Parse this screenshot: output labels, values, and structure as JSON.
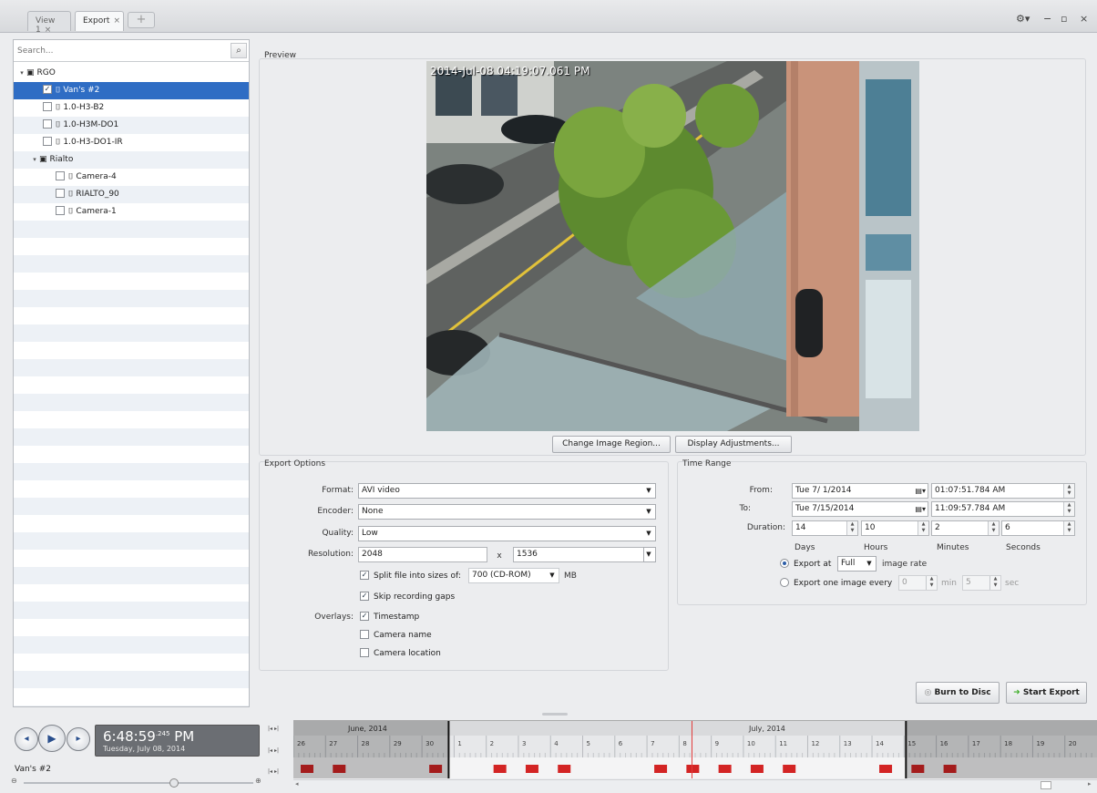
{
  "tabs": [
    {
      "label": "View 1",
      "active": false
    },
    {
      "label": "Export",
      "active": true
    }
  ],
  "tab_add_label": "+",
  "window_controls": {
    "settings": "⚙▾",
    "minimize": "−",
    "restore": "▫",
    "close": "×"
  },
  "search": {
    "placeholder": "Search..."
  },
  "tree": [
    {
      "label": "RGO",
      "type": "site",
      "level": 0,
      "expanded": true,
      "checked": false,
      "selected": false
    },
    {
      "label": "Van's #2",
      "type": "camera",
      "level": 1,
      "checked": true,
      "selected": true
    },
    {
      "label": "1.0-H3-B2",
      "type": "camera",
      "level": 1,
      "checked": false,
      "selected": false
    },
    {
      "label": "1.0-H3M-DO1",
      "type": "camera",
      "level": 1,
      "checked": false,
      "selected": false
    },
    {
      "label": "1.0-H3-DO1-IR",
      "type": "camera",
      "level": 1,
      "checked": false,
      "selected": false
    },
    {
      "label": "Rialto",
      "type": "site",
      "level": 0,
      "expanded": true,
      "checked": false,
      "selected": false
    },
    {
      "label": "Camera-4",
      "type": "camera",
      "level": 2,
      "checked": false,
      "selected": false
    },
    {
      "label": "RIALTO_90",
      "type": "camera",
      "level": 2,
      "checked": false,
      "selected": false
    },
    {
      "label": "Camera-1",
      "type": "camera",
      "level": 2,
      "checked": false,
      "selected": false
    }
  ],
  "preview": {
    "label": "Preview",
    "timestamp": "2014-Jul-08 04:19:07.061 PM",
    "change_region_button": "Change Image Region...",
    "display_adjust_button": "Display Adjustments..."
  },
  "export_options": {
    "title": "Export Options",
    "format_label": "Format:",
    "format_value": "AVI video",
    "encoder_label": "Encoder:",
    "encoder_value": "None",
    "quality_label": "Quality:",
    "quality_value": "Low",
    "resolution_label": "Resolution:",
    "resolution_w": "2048",
    "resolution_x": "x",
    "resolution_h": "1536",
    "split_label": "Split file into sizes of:",
    "split_checked": true,
    "split_value": "700 (CD-ROM)",
    "split_unit": "MB",
    "skip_gaps_label": "Skip recording gaps",
    "skip_gaps_checked": true,
    "overlays_label": "Overlays:",
    "overlay_timestamp": "Timestamp",
    "overlay_timestamp_checked": true,
    "overlay_camera_name": "Camera name",
    "overlay_camera_name_checked": false,
    "overlay_camera_location": "Camera location",
    "overlay_camera_location_checked": false
  },
  "time_range": {
    "title": "Time Range",
    "from_label": "From:",
    "from_date": "Tue  7/ 1/2014",
    "from_time": "01:07:51.784  AM",
    "to_label": "To:",
    "to_date": "Tue  7/15/2014",
    "to_time": "11:09:57.784  AM",
    "duration_label": "Duration:",
    "duration_days": "14",
    "duration_hours": "10",
    "duration_minutes": "2",
    "duration_seconds": "6",
    "days_label": "Days",
    "hours_label": "Hours",
    "minutes_label": "Minutes",
    "seconds_label": "Seconds",
    "export_at_label": "Export at",
    "export_at_value": "Full",
    "image_rate_label": "image rate",
    "export_one_label": "Export one image every",
    "export_one_min": "0",
    "min_label": "min",
    "export_one_sec": "5",
    "sec_label": "sec"
  },
  "actions": {
    "burn_button": "Burn to Disc",
    "start_button": "Start Export"
  },
  "playback": {
    "time": "6:48:59",
    "ms": ".245",
    "ampm": "PM",
    "date": "Tuesday, July 08, 2014",
    "camera_label": "Van's #2"
  },
  "timeline": {
    "month_left": "June, 2014",
    "month_right": "July, 2014",
    "days": [
      "26",
      "27",
      "28",
      "29",
      "30",
      "1",
      "2",
      "3",
      "4",
      "5",
      "6",
      "7",
      "8",
      "9",
      "10",
      "11",
      "12",
      "13",
      "14",
      "15",
      "16",
      "17",
      "18",
      "19",
      "20"
    ],
    "recording_days": [
      "26",
      "27",
      "30",
      "2",
      "3",
      "4",
      "7",
      "8",
      "9",
      "10",
      "11",
      "14",
      "15",
      "16"
    ],
    "selection_start_day": "1",
    "selection_end_day": "15",
    "playhead_day": "8"
  },
  "colors": {
    "selection_blue": "#2f6dc4",
    "recording_red": "#d32424",
    "playhead_red": "#e23a3a",
    "start_export_green": "#3fae2a"
  }
}
